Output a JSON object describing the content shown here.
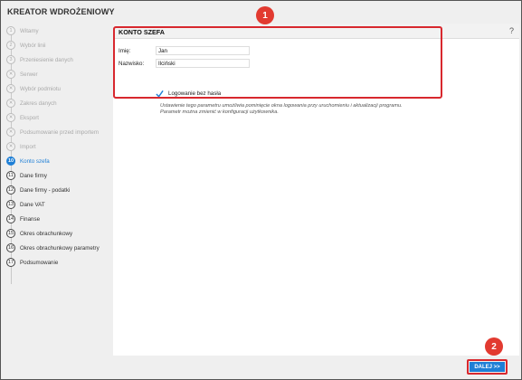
{
  "window": {
    "title": "KREATOR WDROŻENIOWY"
  },
  "steps": [
    {
      "num": "1",
      "label": "Witamy",
      "state": "done"
    },
    {
      "num": "2",
      "label": "Wybór linii",
      "state": "done"
    },
    {
      "num": "3",
      "label": "Przeniesienie danych",
      "state": "done"
    },
    {
      "num": "✕",
      "label": "Serwer",
      "state": "done"
    },
    {
      "num": "✕",
      "label": "Wybór podmiotu",
      "state": "done"
    },
    {
      "num": "✕",
      "label": "Zakres danych",
      "state": "done"
    },
    {
      "num": "✕",
      "label": "Eksport",
      "state": "done"
    },
    {
      "num": "✕",
      "label": "Podsumowanie przed importem",
      "state": "done"
    },
    {
      "num": "✕",
      "label": "Import",
      "state": "done"
    },
    {
      "num": "10",
      "label": "Konto szefa",
      "state": "active"
    },
    {
      "num": "11",
      "label": "Dane firmy",
      "state": "upcoming"
    },
    {
      "num": "12",
      "label": "Dane firmy - podatki",
      "state": "upcoming"
    },
    {
      "num": "13",
      "label": "Dane VAT",
      "state": "upcoming"
    },
    {
      "num": "14",
      "label": "Finanse",
      "state": "upcoming"
    },
    {
      "num": "15",
      "label": "Okres obrachunkowy",
      "state": "upcoming"
    },
    {
      "num": "16",
      "label": "Okres obrachunkowy parametry",
      "state": "upcoming"
    },
    {
      "num": "17",
      "label": "Podsumowanie",
      "state": "upcoming"
    }
  ],
  "section": {
    "title": "KONTO SZEFA",
    "help": "?"
  },
  "form": {
    "first_name_label": "Imię:",
    "first_name_value": "Jan",
    "last_name_label": "Nazwisko:",
    "last_name_value": "Ilciński",
    "checkbox_label": "Logowanie bez hasła",
    "checkbox_checked": true,
    "hint_line1": "Ustawienie tego parametru umożliwia pominięcie okna logowania przy uruchomieniu i aktualizacji programu.",
    "hint_line2": "Parametr można zmienić w konfiguracji użytkownika."
  },
  "annotations": {
    "badge1": "1",
    "badge2": "2"
  },
  "footer": {
    "next_label": "DALEJ >>"
  },
  "colors": {
    "accent": "#1e7fd6",
    "annotation": "#d8282e"
  }
}
